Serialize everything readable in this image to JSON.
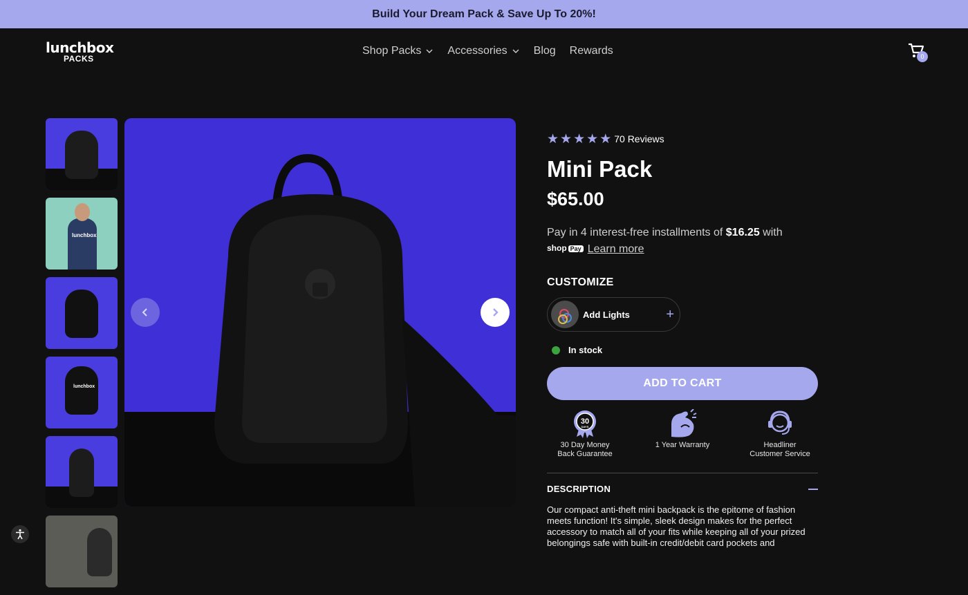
{
  "announcement": "Build Your Dream Pack & Save Up To 20%!",
  "logo": {
    "line1": "lunchbox",
    "line2": "PACKS"
  },
  "nav": [
    {
      "label": "Shop Packs",
      "dropdown": true
    },
    {
      "label": "Accessories",
      "dropdown": true
    },
    {
      "label": "Blog",
      "dropdown": false
    },
    {
      "label": "Rewards",
      "dropdown": false
    }
  ],
  "cart": {
    "count": "0",
    "icon": "cart-icon"
  },
  "product": {
    "rating_stars": 5,
    "reviews": "70 Reviews",
    "title": "Mini Pack",
    "price": "$65.00",
    "installments": {
      "prefix": "Pay in 4 interest-free installments of ",
      "amount": "$16.25",
      "suffix": " with",
      "provider": "shop",
      "provider_badge": "Pay",
      "learn_more": "Learn more"
    },
    "customize_heading": "CUSTOMIZE",
    "addon_label": "Add Lights",
    "stock": "In stock",
    "add_to_cart": "ADD TO CART",
    "badges": [
      {
        "icon": "medal-icon",
        "badge_text": "30",
        "badge_sub": "DAYS",
        "line1": "30 Day Money",
        "line2": "Back Guarantee"
      },
      {
        "icon": "flexed-arm-icon",
        "line1": "1 Year Warranty",
        "line2": ""
      },
      {
        "icon": "headset-icon",
        "line1": "Headliner",
        "line2": "Customer Service"
      }
    ],
    "description_heading": "DESCRIPTION",
    "description": "Our compact anti-theft mini backpack is the epitome of fashion meets function! It's simple, sleek design makes for the perfect accessory to match all of your fits while keeping all of your prized belongings safe with built-in credit/debit card pockets and"
  },
  "thumb_text": "lunchbox",
  "colors": {
    "accent": "#a6a8ee",
    "background": "#111111",
    "image_bg": "#3f2fd6",
    "in_stock": "#3da43d"
  }
}
